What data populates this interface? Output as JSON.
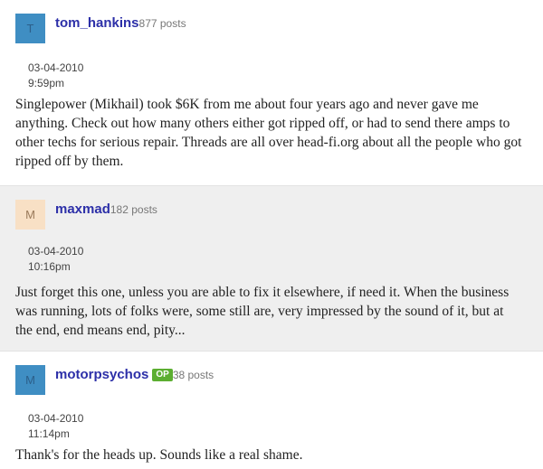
{
  "colors": {
    "username": "#2c2fa8",
    "op_badge": "#5cae31",
    "alt_post_background": "#efefef"
  },
  "posts": [
    {
      "avatar_letter": "T",
      "avatar_color": "#3f8ec3",
      "avatar_text_color": "#2c5f8a",
      "username": "tom_hankins",
      "post_count": "877 posts",
      "is_op": false,
      "date": "03-04-2010",
      "time": "9:59pm",
      "body": "Singlepower (Mikhail) took $6K from me about four years ago and never gave me anything. Check out how many others either got ripped off, or had to send there amps to other techs for serious repair. Threads are all over head-fi.org about all the people who got ripped off by them."
    },
    {
      "avatar_letter": "M",
      "avatar_color": "#f8e0c5",
      "avatar_text_color": "#9a7a5a",
      "username": "maxmad",
      "post_count": "182 posts",
      "is_op": false,
      "date": "03-04-2010",
      "time": "10:16pm",
      "body": "Just forget this one, unless you are able to fix it elsewhere, if need it. When the business was running, lots of folks were, some still are, very impressed by the sound of it, but at the end, end means end, pity..."
    },
    {
      "avatar_letter": "M",
      "avatar_color": "#3f8ec3",
      "avatar_text_color": "#2c5f8a",
      "username": "motorpsychos",
      "op_label": "OP",
      "post_count": "38 posts",
      "is_op": true,
      "date": "03-04-2010",
      "time": "11:14pm",
      "body": "Thank's for the heads up. Sounds like a real shame."
    }
  ]
}
